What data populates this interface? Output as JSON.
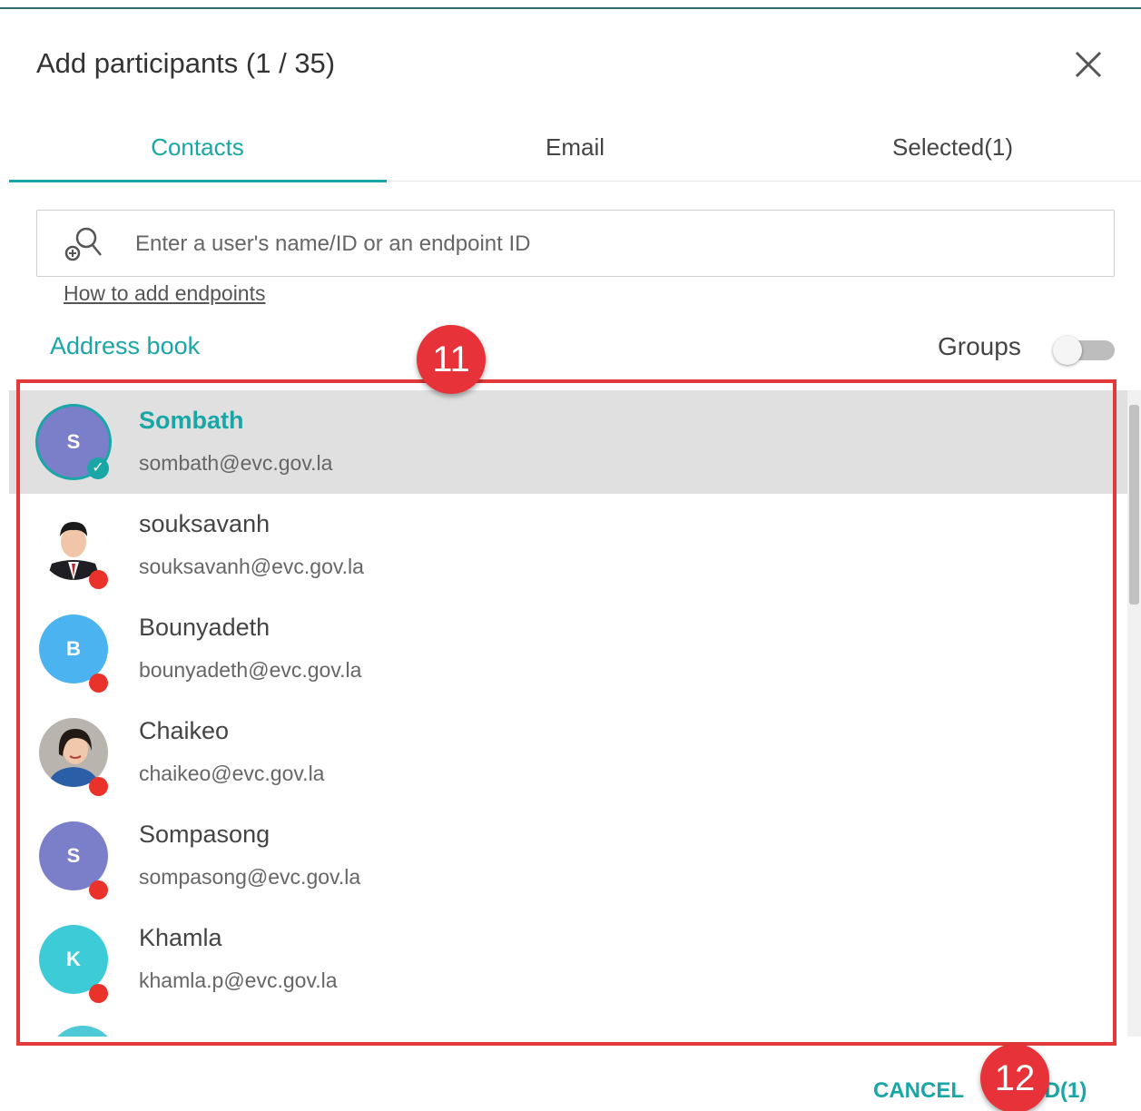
{
  "dialog": {
    "title": "Add participants (1 / 35)",
    "close_icon": "close-icon"
  },
  "tabs": [
    {
      "label": "Contacts",
      "active": true
    },
    {
      "label": "Email",
      "active": false
    },
    {
      "label": "Selected(1)",
      "active": false
    }
  ],
  "search": {
    "icon": "search-user-icon",
    "placeholder": "Enter a user's name/ID or an endpoint ID",
    "value": ""
  },
  "help_link": "How to add endpoints",
  "address_book": "Address book",
  "groups": {
    "label": "Groups",
    "enabled": false
  },
  "contacts": [
    {
      "name": "Sombath",
      "email": "sombath@evc.gov.la",
      "initial": "S",
      "avatar_color": "#7b7fc9",
      "selected": true,
      "status": "selected-check"
    },
    {
      "name": "souksavanh",
      "email": "souksavanh@evc.gov.la",
      "initial": "",
      "avatar_color": "",
      "photo": "man-in-suit-photo",
      "selected": false,
      "status": "offline"
    },
    {
      "name": "Bounyadeth",
      "email": "bounyadeth@evc.gov.la",
      "initial": "B",
      "avatar_color": "#4ab3f0",
      "selected": false,
      "status": "offline"
    },
    {
      "name": "Chaikeo",
      "email": "chaikeo@evc.gov.la",
      "initial": "",
      "avatar_color": "",
      "photo": "woman-photo",
      "selected": false,
      "status": "offline"
    },
    {
      "name": "Sompasong",
      "email": "sompasong@evc.gov.la",
      "initial": "S",
      "avatar_color": "#7b7fc9",
      "selected": false,
      "status": "offline"
    },
    {
      "name": "Khamla",
      "email": "khamla.p@evc.gov.la",
      "initial": "K",
      "avatar_color": "#3ecbd8",
      "selected": false,
      "status": "offline"
    }
  ],
  "footer": {
    "cancel_label": "CANCEL",
    "add_label": "ADD(1)"
  },
  "annotations": [
    {
      "number": "11"
    },
    {
      "number": "12"
    }
  ],
  "colors": {
    "accent": "#1aa6a6",
    "offline_dot": "#e8322a",
    "highlight": "#e03a3a"
  }
}
